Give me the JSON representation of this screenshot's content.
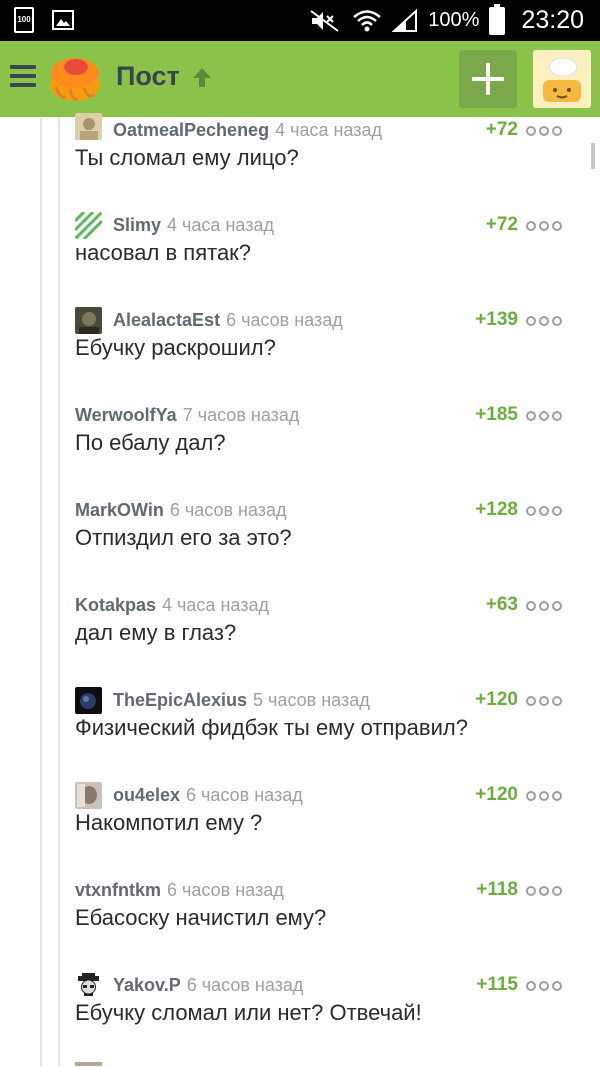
{
  "status_bar": {
    "battery_small": "100",
    "battery_percent": "100%",
    "time": "23:20"
  },
  "app_bar": {
    "title": "Пост"
  },
  "comments": [
    {
      "user": "OatmealPecheneg",
      "time": "4 часа назад",
      "rating": "+72",
      "text": "Ты сломал ему лицо?",
      "avatar": "photo"
    },
    {
      "user": "Slimy",
      "time": "4 часа назад",
      "rating": "+72",
      "text": "насовал в пятак?",
      "avatar": "green-stripes"
    },
    {
      "user": "AlealactaEst",
      "time": "6 часов назад",
      "rating": "+139",
      "text": "Ебучку раскрошил?",
      "avatar": "photo"
    },
    {
      "user": "WerwoolfYa",
      "time": "7 часов назад",
      "rating": "+185",
      "text": "По ебалу дал?",
      "avatar": ""
    },
    {
      "user": "MarkOWin",
      "time": "6 часов назад",
      "rating": "+128",
      "text": "Отпиздил его за это?",
      "avatar": ""
    },
    {
      "user": "Kotakpas",
      "time": "4 часа назад",
      "rating": "+63",
      "text": "дал ему в глаз?",
      "avatar": ""
    },
    {
      "user": "TheEpicAlexius",
      "time": "5 часов назад",
      "rating": "+120",
      "text": "Физический фидбэк ты ему отправил?",
      "avatar": "dark"
    },
    {
      "user": "ou4elex",
      "time": "6 часов назад",
      "rating": "+120",
      "text": "Накомпотил ему ?",
      "avatar": "photo"
    },
    {
      "user": "vtxnfntkm",
      "time": "6 часов назад",
      "rating": "+118",
      "text": "Ебасоску начистил ему?",
      "avatar": ""
    },
    {
      "user": "Yakov.P",
      "time": "6 часов назад",
      "rating": "+115",
      "text": "Ебучку сломал или нет? Отвечай!",
      "avatar": "heisenberg"
    }
  ],
  "colors": {
    "app_bar": "#8bc34a",
    "rating": "#6cae3d",
    "username": "#5f6a72",
    "timestamp": "#9aa0a4"
  }
}
